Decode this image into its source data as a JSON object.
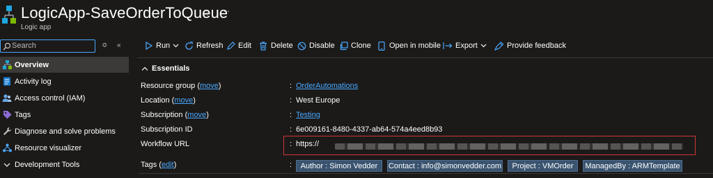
{
  "header": {
    "title": "LogicApp-SaveOrderToQueue",
    "subtitle": "Logic app",
    "star_icon": "star-outline-icon",
    "more_icon": "ellipsis-icon"
  },
  "sidebar": {
    "search_placeholder": "Search",
    "items": [
      {
        "label": "Overview",
        "icon": "overview-icon",
        "active": true
      },
      {
        "label": "Activity log",
        "icon": "activity-log-icon"
      },
      {
        "label": "Access control (IAM)",
        "icon": "people-icon"
      },
      {
        "label": "Tags",
        "icon": "tag-icon"
      },
      {
        "label": "Diagnose and solve problems",
        "icon": "wrench-icon"
      },
      {
        "label": "Resource visualizer",
        "icon": "network-icon"
      },
      {
        "label": "Development Tools",
        "icon": "chevron-down-icon"
      }
    ]
  },
  "toolbar": {
    "run": "Run",
    "refresh": "Refresh",
    "edit": "Edit",
    "delete": "Delete",
    "disable": "Disable",
    "clone": "Clone",
    "open_mobile": "Open in mobile",
    "export": "Export",
    "feedback": "Provide feedback"
  },
  "essentials": {
    "title": "Essentials",
    "separator": ":",
    "move_link": "move",
    "edit_link": "edit",
    "resource_group": {
      "label": "Resource group",
      "value": "OrderAutomations"
    },
    "location": {
      "label": "Location",
      "value": "West Europe"
    },
    "subscription": {
      "label": "Subscription",
      "value": "Testing"
    },
    "subscription_id": {
      "label": "Subscription ID",
      "value": "6e009161-8480-4337-ab64-574a4eed8b93"
    },
    "workflow_url": {
      "label": "Workflow URL",
      "value": "https://"
    },
    "tags": {
      "label": "Tags",
      "items": [
        "Author : Simon Vedder",
        "Contact : info@simonvedder.com",
        "Project : VMOrder",
        "ManagedBy : ARMTemplate"
      ]
    }
  },
  "colors": {
    "accent": "#4aa8ff",
    "background": "#1b1a19",
    "highlight_box": "#d13438",
    "tag_chip": "#3a5470"
  }
}
